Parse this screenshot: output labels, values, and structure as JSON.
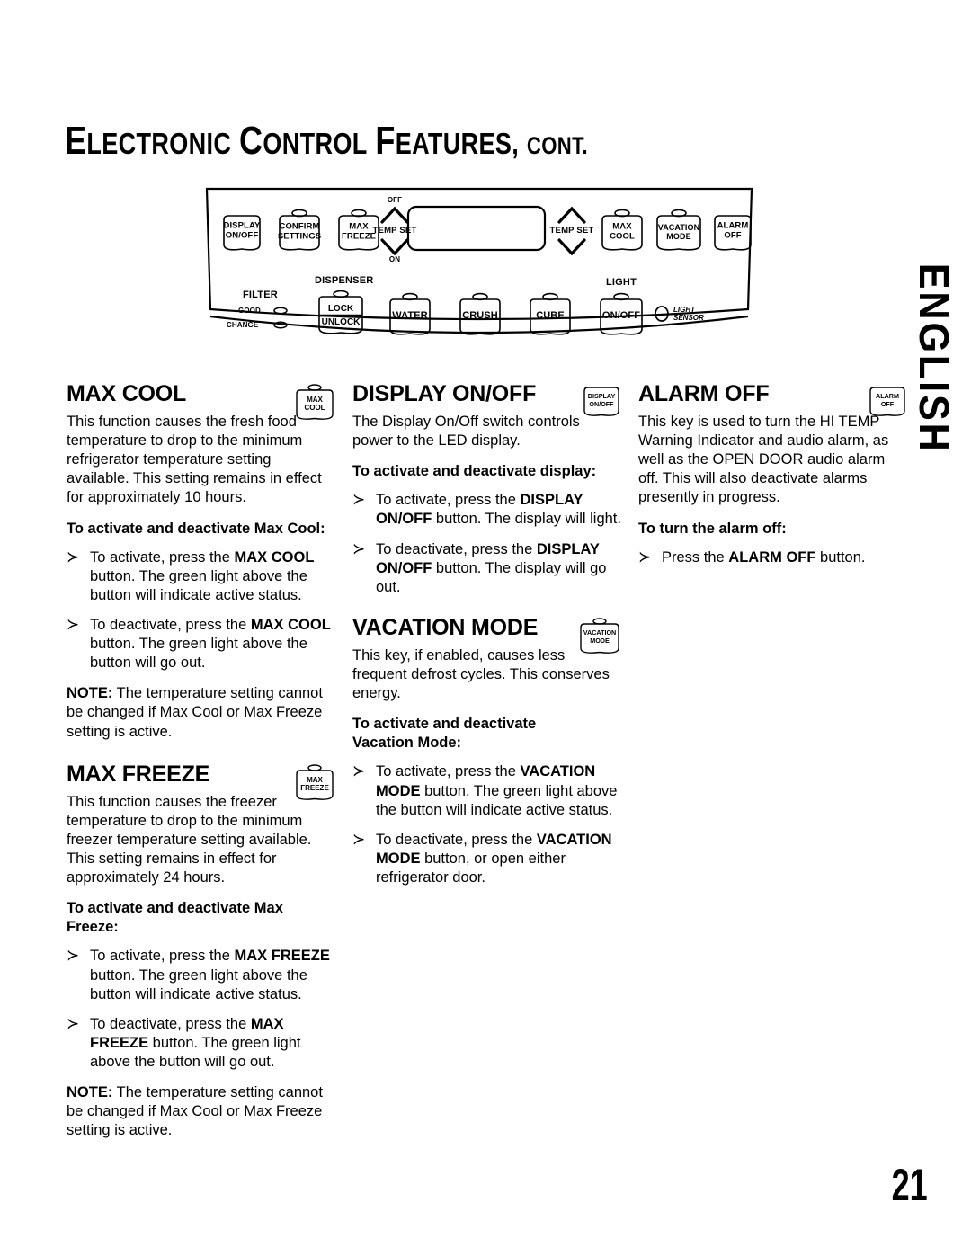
{
  "page": {
    "title_full": "ELECTRONIC CONTROL FEATURES, CONT.",
    "title_part_1": "E",
    "title_part_2": "LECTRONIC",
    "title_part_3": "C",
    "title_part_4": "ONTROL",
    "title_part_5": "F",
    "title_part_6": "EATURES,",
    "title_part_7": "CONT.",
    "side_tab": "ENGLISH",
    "number": "21"
  },
  "control_panel": {
    "top_row": {
      "buttons": [
        {
          "label_line1": "DISPLAY",
          "label_line2": "ON/OFF",
          "led": false
        },
        {
          "label_line1": "CONFIRM",
          "label_line2": "SETTINGS",
          "led": true
        },
        {
          "label_line1": "MAX",
          "label_line2": "FREEZE",
          "led": true
        },
        {
          "label_line1": "MAX",
          "label_line2": "COOL",
          "led": true
        },
        {
          "label_line1": "VACATION",
          "label_line2": "MODE",
          "led": true
        },
        {
          "label_line1": "ALARM",
          "label_line2": "OFF",
          "led": false
        }
      ],
      "temp_set_left": {
        "label": "TEMP SET",
        "up_label": "OFF",
        "down_label": "ON"
      },
      "temp_set_right": {
        "label": "TEMP SET",
        "up_label": "",
        "down_label": ""
      },
      "display_window": ""
    },
    "bottom_row": {
      "filter_group_label": "FILTER",
      "filter_indicators": [
        {
          "label": "GOOD"
        },
        {
          "label": "CHANGE"
        }
      ],
      "dispenser_group_label": "DISPENSER",
      "light_group_label": "LIGHT",
      "lock_button": {
        "label_line1": "LOCK",
        "label_line2": "UNLOCK",
        "led": true
      },
      "buttons": [
        {
          "label_line1": "WATER",
          "label_line2": "",
          "led": true
        },
        {
          "label_line1": "CRUSH",
          "label_line2": "",
          "led": true
        },
        {
          "label_line1": "CUBE",
          "label_line2": "",
          "led": true
        },
        {
          "label_line1": "ON/OFF",
          "label_line2": "",
          "led": true
        }
      ],
      "light_sensor": {
        "label_line1": "LIGHT",
        "label_line2": "SENSOR"
      }
    }
  },
  "sections": {
    "max_cool": {
      "heading": "MAX COOL",
      "icon_line1": "MAX",
      "icon_line2": "COOL",
      "body": "This function causes the fresh food temperature to drop to the minimum refrigerator temperature setting available. This setting remains in effect for approximately 10 hours.",
      "subhead": "To activate and deactivate Max Cool:",
      "bullets": [
        {
          "pre": "To activate, press the ",
          "bold": "MAX COOL",
          "post": " button. The green light above the button will indicate active status."
        },
        {
          "pre": "To deactivate, press the ",
          "bold": "MAX COOL",
          "post": " button. The green light above the button will go out."
        }
      ],
      "note_label": "NOTE:",
      "note_text": "The temperature setting cannot be changed if Max Cool or Max Freeze setting is active."
    },
    "max_freeze": {
      "heading": "MAX FREEZE",
      "icon_line1": "MAX",
      "icon_line2": "FREEZE",
      "body": "This function causes the freezer temperature to drop to the minimum freezer temperature setting available. This setting remains in effect for approximately 24 hours.",
      "subhead": "To activate and deactivate Max Freeze:",
      "bullets": [
        {
          "pre": "To activate, press the ",
          "bold": "MAX FREEZE",
          "post": " button. The green light above the button will indicate active status."
        },
        {
          "pre": "To deactivate, press the ",
          "bold": "MAX FREEZE",
          "post": " button. The green light above the button will go out."
        }
      ],
      "note_label": "NOTE:",
      "note_text": "The temperature setting cannot be changed if Max Cool or Max Freeze setting is active."
    },
    "display_on_off": {
      "heading": "DISPLAY ON/OFF",
      "icon_line1": "DISPLAY",
      "icon_line2": "ON/OFF",
      "body": "The Display On/Off switch controls power to the LED display.",
      "subhead": "To activate and deactivate display:",
      "bullets": [
        {
          "pre": "To activate, press the ",
          "bold": "DISPLAY ON/OFF",
          "post": " button. The display will light."
        },
        {
          "pre": "To deactivate, press the ",
          "bold": "DISPLAY ON/OFF",
          "post": " button. The display will go out."
        }
      ]
    },
    "vacation_mode": {
      "heading": "VACATION MODE",
      "icon_line1": "VACATION",
      "icon_line2": "MODE",
      "body": "This key, if enabled, causes less frequent defrost cycles. This conserves energy.",
      "subhead": "To activate and deactivate Vacation Mode:",
      "bullets": [
        {
          "pre": "To activate, press the ",
          "bold": "VACATION MODE",
          "post": " button. The green light above the button will indicate active status."
        },
        {
          "pre": "To deactivate, press the ",
          "bold": "VACATION MODE",
          "post": " button, or open either refrigerator door."
        }
      ]
    },
    "alarm_off": {
      "heading": "ALARM OFF",
      "icon_line1": "ALARM",
      "icon_line2": "OFF",
      "body": "This key is used to turn the HI TEMP Warning Indicator and audio alarm, as well as the OPEN DOOR audio alarm off. This will also deactivate alarms presently in progress.",
      "subhead": "To turn the alarm off:",
      "bullets": [
        {
          "pre": "Press the ",
          "bold": "ALARM OFF",
          "post": " button."
        }
      ]
    }
  },
  "glyphs": {
    "bullet": "≻"
  }
}
